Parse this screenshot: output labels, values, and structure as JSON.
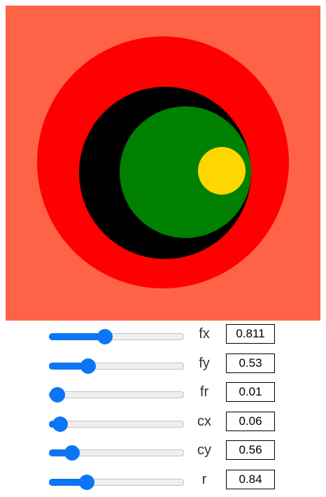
{
  "canvas": {
    "background_color": "#FF6347",
    "gradient_stops": [
      {
        "color": "#FFD700"
      },
      {
        "color": "#008000"
      },
      {
        "color": "#000000"
      },
      {
        "color": "#FF0000"
      }
    ]
  },
  "controls": [
    {
      "label": "fx",
      "value": "0.811",
      "slider_value": 0.405
    },
    {
      "label": "fy",
      "value": "0.53",
      "slider_value": 0.265
    },
    {
      "label": "fr",
      "value": "0.01",
      "slider_value": 0.005
    },
    {
      "label": "cx",
      "value": "0.06",
      "slider_value": 0.03
    },
    {
      "label": "cy",
      "value": "0.56",
      "slider_value": 0.13
    },
    {
      "label": "r",
      "value": "0.84",
      "slider_value": 0.25
    }
  ]
}
